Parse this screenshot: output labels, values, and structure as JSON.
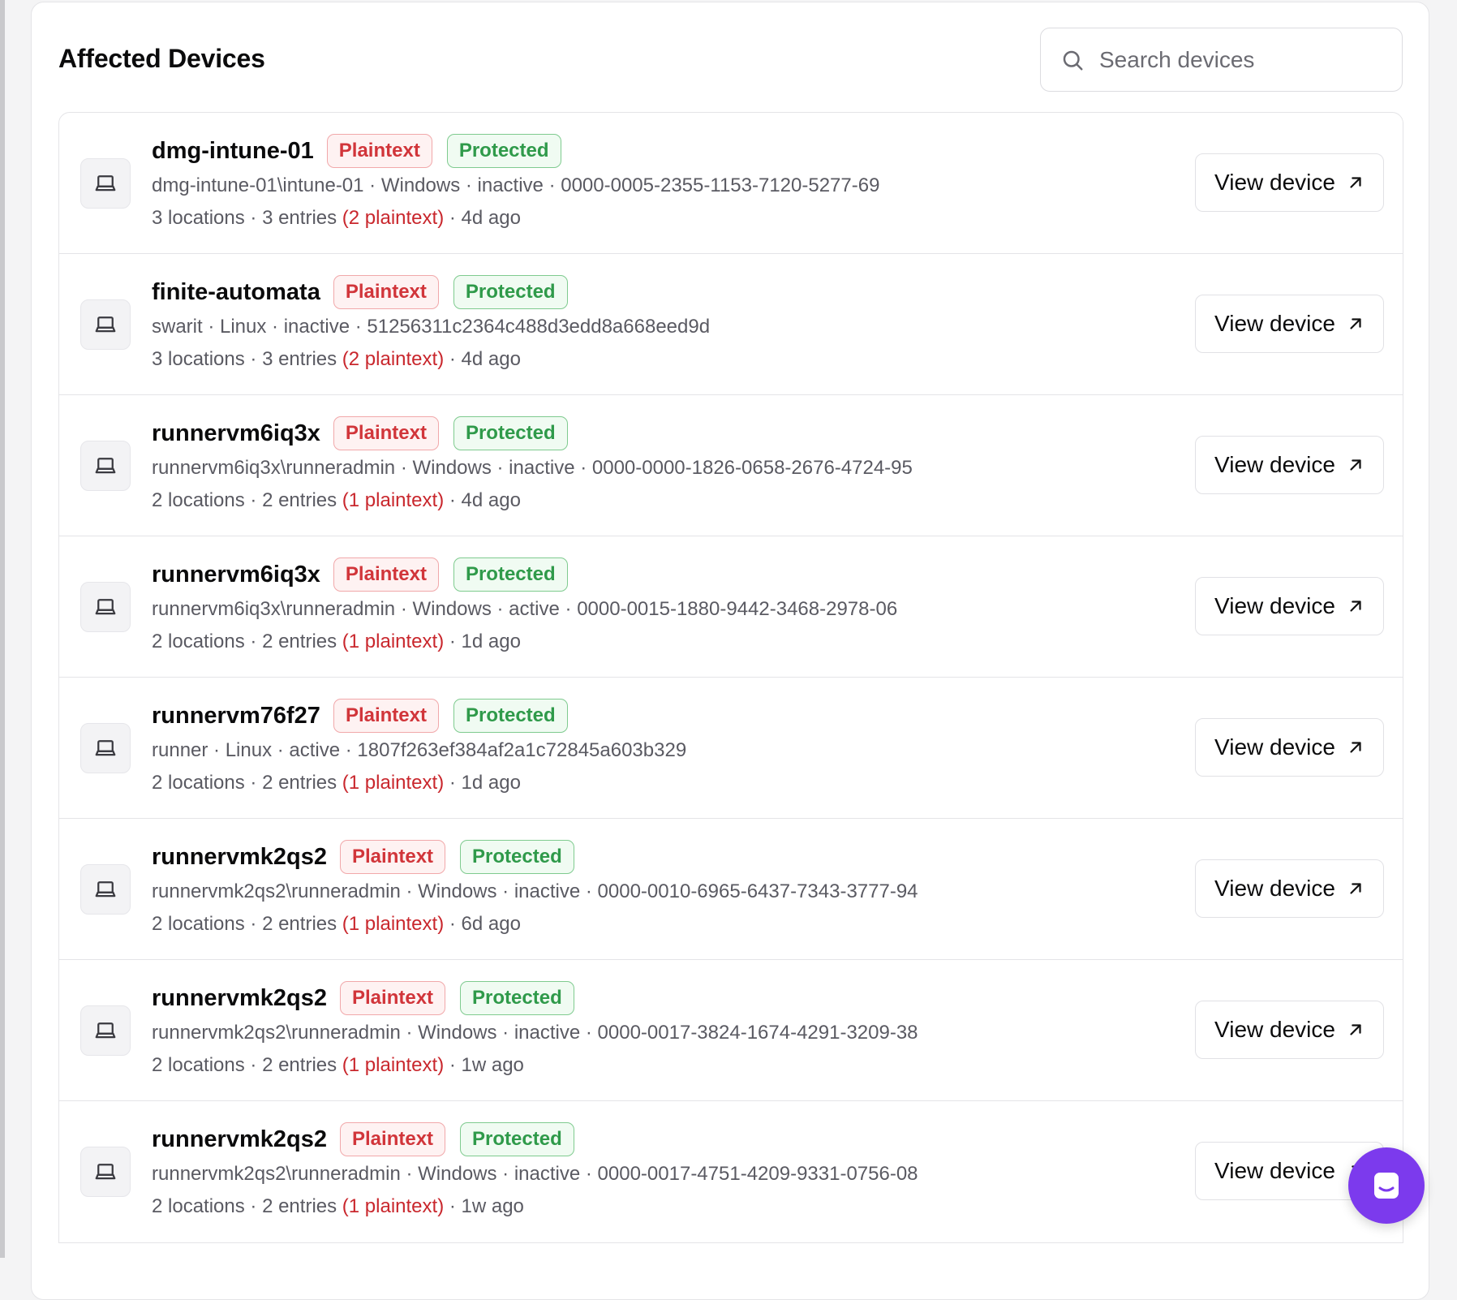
{
  "panel": {
    "title": "Affected Devices",
    "search_placeholder": "Search devices"
  },
  "badges": {
    "plaintext": "Plaintext",
    "protected": "Protected"
  },
  "view_label": "View device",
  "devices": [
    {
      "name": "dmg-intune-01",
      "meta": "dmg-intune-01\\intune-01 · Windows · inactive · 0000-0005-2355-1153-7120-5277-69",
      "counts": "3 locations · 3 entries ",
      "plaintext": "(2 plaintext)",
      "age": " · 4d ago"
    },
    {
      "name": "finite-automata",
      "meta": "swarit · Linux · inactive · 51256311c2364c488d3edd8a668eed9d",
      "counts": "3 locations · 3 entries ",
      "plaintext": "(2 plaintext)",
      "age": " · 4d ago"
    },
    {
      "name": "runnervm6iq3x",
      "meta": "runnervm6iq3x\\runneradmin · Windows · inactive · 0000-0000-1826-0658-2676-4724-95",
      "counts": "2 locations · 2 entries ",
      "plaintext": "(1 plaintext)",
      "age": " · 4d ago"
    },
    {
      "name": "runnervm6iq3x",
      "meta": "runnervm6iq3x\\runneradmin · Windows · active · 0000-0015-1880-9442-3468-2978-06",
      "counts": "2 locations · 2 entries ",
      "plaintext": "(1 plaintext)",
      "age": " · 1d ago"
    },
    {
      "name": "runnervm76f27",
      "meta": "runner · Linux · active · 1807f263ef384af2a1c72845a603b329",
      "counts": "2 locations · 2 entries ",
      "plaintext": "(1 plaintext)",
      "age": " · 1d ago"
    },
    {
      "name": "runnervmk2qs2",
      "meta": "runnervmk2qs2\\runneradmin · Windows · inactive · 0000-0010-6965-6437-7343-3777-94",
      "counts": "2 locations · 2 entries ",
      "plaintext": "(1 plaintext)",
      "age": " · 6d ago"
    },
    {
      "name": "runnervmk2qs2",
      "meta": "runnervmk2qs2\\runneradmin · Windows · inactive · 0000-0017-3824-1674-4291-3209-38",
      "counts": "2 locations · 2 entries ",
      "plaintext": "(1 plaintext)",
      "age": " · 1w ago"
    },
    {
      "name": "runnervmk2qs2",
      "meta": "runnervmk2qs2\\runneradmin · Windows · inactive · 0000-0017-4751-4209-9331-0756-08",
      "counts": "2 locations · 2 entries ",
      "plaintext": "(1 plaintext)",
      "age": " · 1w ago"
    }
  ],
  "icons": {
    "search": "search-icon",
    "device": "laptop-icon",
    "external": "arrow-up-right-icon",
    "chat": "chat-icon"
  },
  "colors": {
    "plaintext": "#d1353a",
    "protected": "#2f9a4a",
    "chat": "#7c3aed"
  }
}
